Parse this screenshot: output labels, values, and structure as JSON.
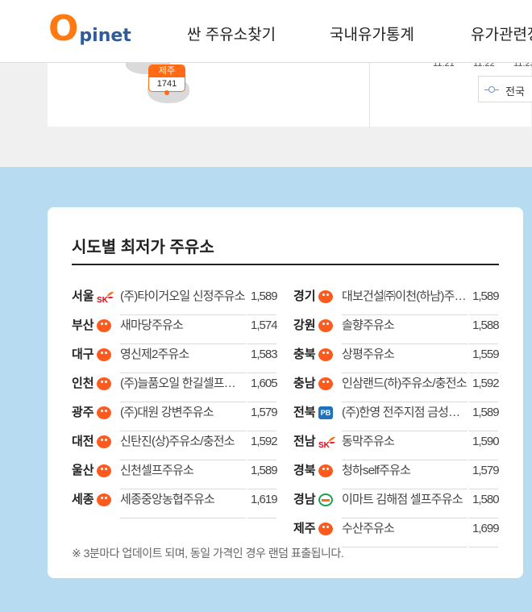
{
  "header": {
    "logo": {
      "letter": "O",
      "rest": "pinet"
    },
    "nav": [
      "싼 주유소찾기",
      "국내유가통계",
      "유가관련정보"
    ]
  },
  "map": {
    "jeju_badge": {
      "name": "제주",
      "value": "1741"
    },
    "chart_ticks": [
      "11.21",
      "11.22",
      "11.23"
    ],
    "legend_label": "전국"
  },
  "lowest": {
    "title": "시도별 최저가 주유소",
    "left": [
      {
        "region": "서울",
        "brand": "sk-energy-icon",
        "name": "(주)타이거오일 신정주유소",
        "price": "1,589"
      },
      {
        "region": "부산",
        "brand": "gs-caltex-icon",
        "name": "새마당주유소",
        "price": "1,574"
      },
      {
        "region": "대구",
        "brand": "gs-caltex-icon",
        "name": "영신제2주유소",
        "price": "1,583"
      },
      {
        "region": "인천",
        "brand": "gs-caltex-icon",
        "name": "(주)늘품오일 한길셀프주유소",
        "price": "1,605"
      },
      {
        "region": "광주",
        "brand": "gs-caltex-icon",
        "name": "(주)대원 강변주유소",
        "price": "1,579"
      },
      {
        "region": "대전",
        "brand": "gs-caltex-icon",
        "name": "신탄진(상)주유소/충전소",
        "price": "1,592"
      },
      {
        "region": "울산",
        "brand": "gs-caltex-icon",
        "name": "신천셀프주유소",
        "price": "1,589"
      },
      {
        "region": "세종",
        "brand": "gs-caltex-icon",
        "name": "세종중앙농협주유소",
        "price": "1,619"
      }
    ],
    "right": [
      {
        "region": "경기",
        "brand": "gs-caltex-icon",
        "name": "대보건설㈜이천(하남)주유소",
        "price": "1,589"
      },
      {
        "region": "강원",
        "brand": "gs-caltex-icon",
        "name": "솔향주유소",
        "price": "1,588"
      },
      {
        "region": "충북",
        "brand": "gs-caltex-icon",
        "name": "상평주유소",
        "price": "1,559"
      },
      {
        "region": "충남",
        "brand": "gs-caltex-icon",
        "name": "인삼랜드(하)주유소/충전소",
        "price": "1,592"
      },
      {
        "region": "전북",
        "brand": "pb-icon",
        "brand_text": "PB",
        "name": "(주)한영 전주지점 금성주유소",
        "price": "1,589"
      },
      {
        "region": "전남",
        "brand": "sk-energy-icon",
        "name": "동막주유소",
        "price": "1,590"
      },
      {
        "region": "경북",
        "brand": "gs-caltex-icon",
        "name": "청하self주유소",
        "price": "1,579"
      },
      {
        "region": "경남",
        "brand": "e1-icon",
        "name": "이마트 김해점 셀프주유소",
        "price": "1,580"
      },
      {
        "region": "제주",
        "brand": "gs-caltex-icon",
        "name": "수산주유소",
        "price": "1,699"
      }
    ],
    "footnote": "※ 3분마다 업데이트 되며, 동일 가격인 경우 랜덤 표출됩니다."
  },
  "colors": {
    "accent_orange": "#ff6a14",
    "logo_blue": "#2f5b9a",
    "section_blue": "#b7dcf1"
  }
}
